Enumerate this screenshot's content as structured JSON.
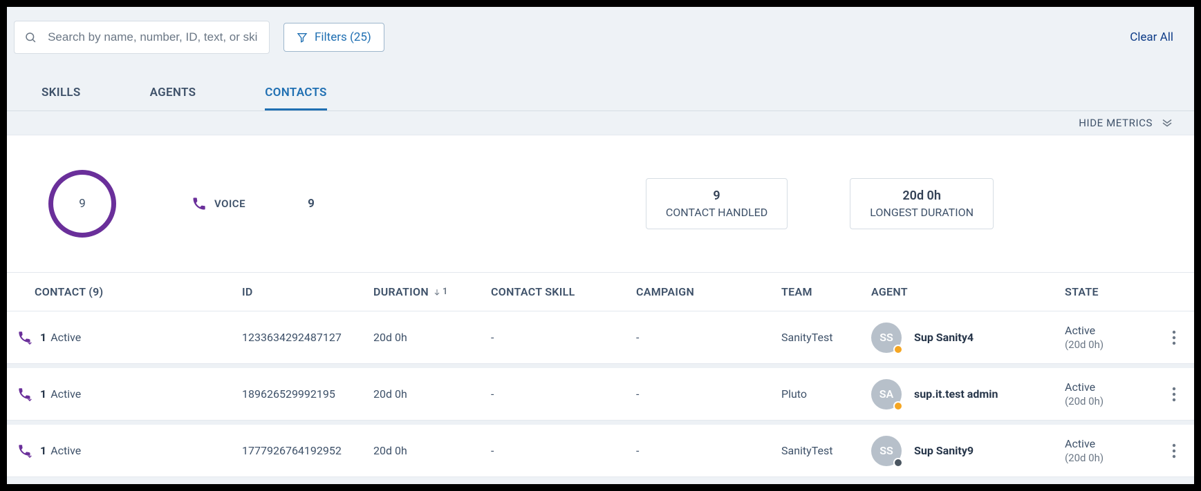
{
  "search": {
    "placeholder": "Search by name, number, ID, text, or skill"
  },
  "filters": {
    "label": "Filters (25)"
  },
  "clear_all": "Clear All",
  "tabs": {
    "skills": "SKILLS",
    "agents": "AGENTS",
    "contacts": "CONTACTS"
  },
  "hide_metrics": "HIDE METRICS",
  "metrics": {
    "ring_value": "9",
    "voice_label": "VOICE",
    "voice_value": "9",
    "handled": {
      "value": "9",
      "label": "CONTACT HANDLED"
    },
    "longest": {
      "value": "20d 0h",
      "label": "LONGEST DURATION"
    }
  },
  "columns": {
    "contact": "CONTACT (9)",
    "id": "ID",
    "duration": "DURATION",
    "sort_num": "1",
    "skill": "CONTACT SKILL",
    "campaign": "CAMPAIGN",
    "team": "TEAM",
    "agent": "AGENT",
    "state": "STATE"
  },
  "rows": [
    {
      "contact_count": "1",
      "contact_status": "Active",
      "id": "1233634292487127",
      "duration": "20d 0h",
      "skill": "-",
      "campaign": "-",
      "team": "SanityTest",
      "agent_initials": "SS",
      "agent_name": "Sup Sanity4",
      "badge": "orange",
      "state": "Active",
      "state_sub": "(20d 0h)"
    },
    {
      "contact_count": "1",
      "contact_status": "Active",
      "id": "189626529992195",
      "duration": "20d 0h",
      "skill": "-",
      "campaign": "-",
      "team": "Pluto",
      "agent_initials": "SA",
      "agent_name": "sup.it.test admin",
      "badge": "orange",
      "state": "Active",
      "state_sub": "(20d 0h)"
    },
    {
      "contact_count": "1",
      "contact_status": "Active",
      "id": "1777926764192952",
      "duration": "20d 0h",
      "skill": "-",
      "campaign": "-",
      "team": "SanityTest",
      "agent_initials": "SS",
      "agent_name": "Sup Sanity9",
      "badge": "dark",
      "state": "Active",
      "state_sub": "(20d 0h)"
    }
  ]
}
